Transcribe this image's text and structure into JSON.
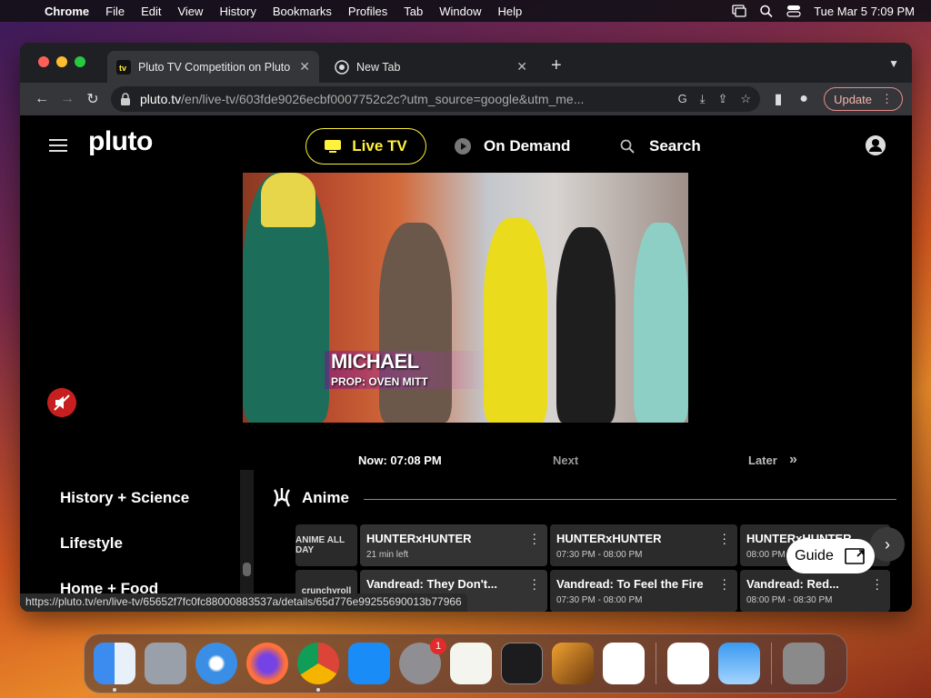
{
  "menubar": {
    "app_name": "Chrome",
    "items": [
      "File",
      "Edit",
      "View",
      "History",
      "Bookmarks",
      "Profiles",
      "Tab",
      "Window",
      "Help"
    ],
    "clock": "Tue Mar 5  7:09 PM"
  },
  "browser": {
    "tabs": [
      {
        "title": "Pluto TV Competition on Pluto",
        "active": true
      },
      {
        "title": "New Tab",
        "active": false
      }
    ],
    "url_host": "pluto.tv",
    "url_path": "/en/live-tv/603fde9026ecbf0007752c2c?utm_source=google&utm_me...",
    "update_label": "Update",
    "status_url": "https://pluto.tv/en/live-tv/65652f7fc0fc88000883537a/details/65d776e99255690013b77966"
  },
  "pluto": {
    "logo": "pluto",
    "nav": {
      "live_tv": "Live TV",
      "on_demand": "On Demand",
      "search": "Search"
    },
    "player": {
      "lower_third_name": "MICHAEL",
      "lower_third_sub": "PROP: OVEN MITT"
    },
    "timeline": {
      "now": "Now: 07:08 PM",
      "next": "Next",
      "later": "Later"
    },
    "categories": [
      "History + Science",
      "Lifestyle",
      "Home + Food"
    ],
    "section_title": "Anime",
    "guide_label": "Guide",
    "rows": [
      {
        "channel_logo": "ANIME ALL DAY",
        "programs": [
          {
            "title": "HUNTERxHUNTER",
            "sub": "21 min left"
          },
          {
            "title": "HUNTERxHUNTER",
            "sub": "07:30 PM - 08:00 PM"
          },
          {
            "title": "HUNTERxHUNTER",
            "sub": "08:00 PM"
          }
        ]
      },
      {
        "channel_logo": "crunchyroll",
        "programs": [
          {
            "title": "Vandread: They Don't...",
            "sub": ""
          },
          {
            "title": "Vandread: To Feel the Fire",
            "sub": "07:30 PM - 08:00 PM"
          },
          {
            "title": "Vandread: Red...",
            "sub": "08:00 PM - 08:30 PM"
          }
        ]
      }
    ]
  },
  "dock": {
    "apps": [
      "Finder",
      "Launchpad",
      "Safari",
      "Firefox",
      "Chrome",
      "App Store",
      "System Settings",
      "TextEdit",
      "Terminal",
      "GarageBand",
      "VS Code",
      "Visual Studio",
      "Weather",
      "Trash"
    ],
    "settings_badge": "1"
  },
  "colors": {
    "accent_yellow": "#fff23a",
    "mute_red": "#c71f1f"
  }
}
